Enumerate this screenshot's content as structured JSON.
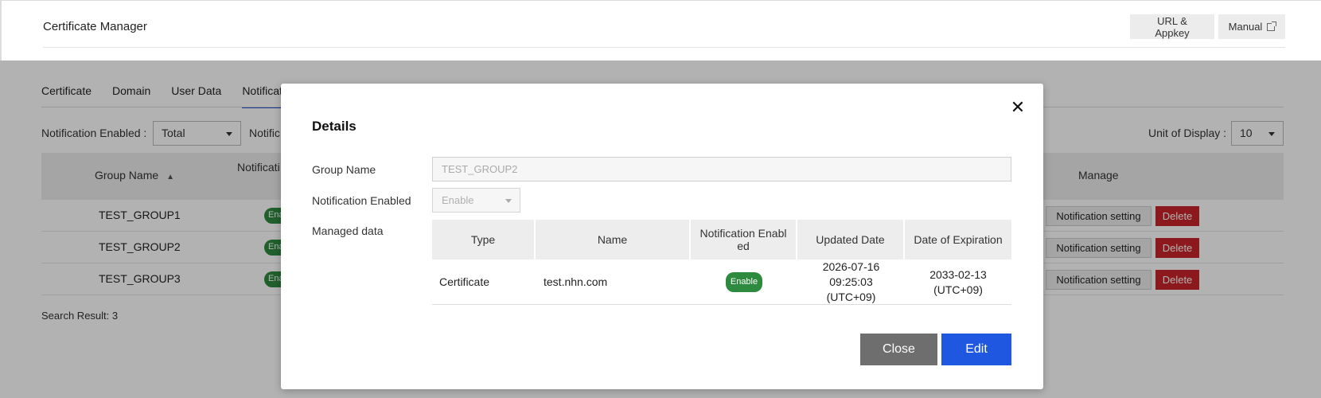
{
  "app": {
    "title": "Certificate Manager",
    "url_appkey_label": "URL & Appkey",
    "manual_label": "Manual"
  },
  "tabs": [
    {
      "label": "Certificate",
      "active": false
    },
    {
      "label": "Domain",
      "active": false
    },
    {
      "label": "User Data",
      "active": false
    },
    {
      "label": "Notificati",
      "active": true
    }
  ],
  "filters": {
    "notification_enabled_label": "Notification Enabled  :",
    "notification_enabled_value": "Total",
    "second_filter_label_partial": "Notific",
    "unit_of_display_label": "Unit of Display  :",
    "unit_of_display_value": "10"
  },
  "table": {
    "columns": [
      "Group Name",
      "Notificati",
      "Manage"
    ],
    "rows": [
      {
        "group_name": "TEST_GROUP1",
        "badge": "Ena"
      },
      {
        "group_name": "TEST_GROUP2",
        "badge": "Ena"
      },
      {
        "group_name": "TEST_GROUP3",
        "badge": "Ena"
      }
    ],
    "notification_setting_label": "Notification setting",
    "delete_label": "Delete"
  },
  "search_result": "Search Result: 3",
  "modal": {
    "title": "Details",
    "close_icon": "close-icon",
    "group_name_label": "Group Name",
    "group_name_value": "TEST_GROUP2",
    "notification_enabled_label": "Notification Enabled",
    "notification_enabled_value": "Enable",
    "managed_data_label": "Managed data",
    "managed_table": {
      "columns": [
        "Type",
        "Name",
        "Notification Enabl ed",
        "Updated Date",
        "Date of Expiration"
      ],
      "rows": [
        {
          "type": "Certificate",
          "name": "test.nhn.com",
          "notification": "Enable",
          "updated_date": "2026-07-16 09:25:03 (UTC+09)",
          "expiration": "2033-02-13 (UTC+09)"
        }
      ]
    },
    "close_button": "Close",
    "edit_button": "Edit"
  },
  "colors": {
    "primary": "#1f57e0",
    "danger": "#c8242c",
    "success": "#2d8a3e",
    "tab_active": "#2251d6"
  }
}
